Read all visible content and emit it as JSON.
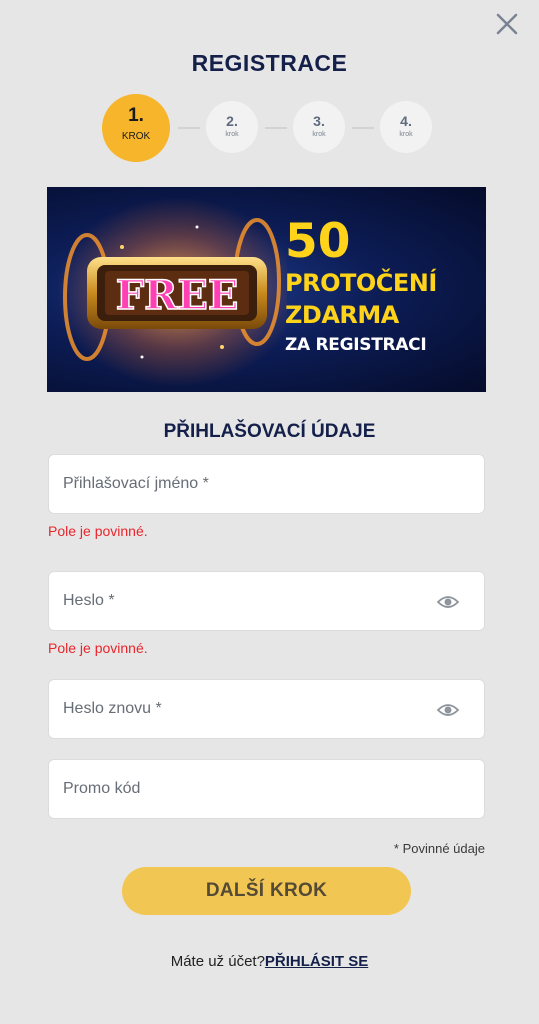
{
  "dialog": {
    "title": "REGISTRACE",
    "close_icon": "close-icon"
  },
  "steps": [
    {
      "num": "1.",
      "label": "KROK",
      "active": true
    },
    {
      "num": "2.",
      "label": "krok",
      "active": false
    },
    {
      "num": "3.",
      "label": "krok",
      "active": false
    },
    {
      "num": "4.",
      "label": "krok",
      "active": false
    }
  ],
  "banner": {
    "number": "50",
    "line1": "PROTOČENÍ",
    "line2": "ZDARMA",
    "line3": "ZA REGISTRACI",
    "reel_text": "FREE"
  },
  "form": {
    "section_title": "PŘIHLAŠOVACÍ ÚDAJE",
    "username_placeholder": "Přihlašovací jméno *",
    "username_error": "Pole je povinné.",
    "password_placeholder": "Heslo *",
    "password_error": "Pole je povinné.",
    "password_repeat_placeholder": "Heslo znovu *",
    "promo_placeholder": "Promo kód",
    "required_note": "* Povinné údaje",
    "next_button": "DALŠÍ KROK"
  },
  "footer": {
    "question": "Máte už účet?",
    "login_link": "PŘIHLÁSIT SE"
  },
  "colors": {
    "accent": "#f7b52b",
    "button": "#f2c653",
    "title": "#14204a",
    "error": "#e8262c",
    "background": "#e6e6e6"
  }
}
